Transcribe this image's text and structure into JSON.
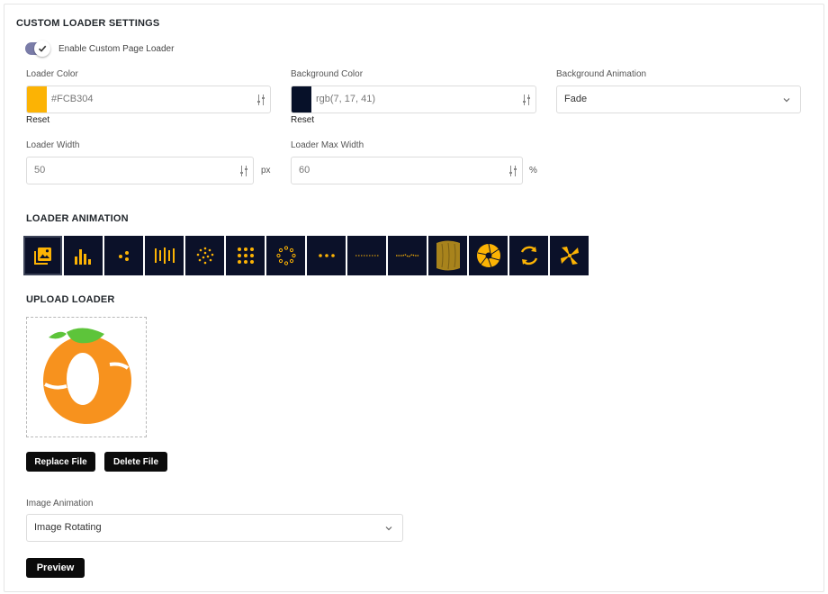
{
  "section_title": "CUSTOM LOADER SETTINGS",
  "enable_loader": {
    "label": "Enable Custom Page Loader",
    "checked": true
  },
  "loader_color": {
    "label": "Loader Color",
    "value": "#FCB304",
    "swatch": "#fcb304",
    "reset": "Reset"
  },
  "background_color": {
    "label": "Background Color",
    "value": "rgb(7, 17, 41)",
    "swatch": "#071129",
    "reset": "Reset"
  },
  "background_animation": {
    "label": "Background Animation",
    "value": "Fade"
  },
  "loader_width": {
    "label": "Loader Width",
    "value": "50",
    "unit": "px"
  },
  "loader_max_width": {
    "label": "Loader Max Width",
    "value": "60",
    "unit": "%"
  },
  "loader_animation": {
    "title": "LOADER ANIMATION",
    "selected": "image-icon",
    "icons": [
      "image-icon",
      "bars-icon",
      "dots-triangle-icon",
      "vertical-bars-icon",
      "dot-burst-icon",
      "dot-grid-icon",
      "dot-ring-icon",
      "three-dots-icon",
      "dashed-line-icon",
      "wave-line-icon",
      "cylinder-icon",
      "aperture-icon",
      "circular-arrows-icon",
      "pinwheel-icon"
    ],
    "accent": "#fcb304"
  },
  "upload_loader": {
    "title": "UPLOAD LOADER",
    "image_icon": "orange-fruit-logo-icon"
  },
  "buttons": {
    "replace": "Replace File",
    "delete": "Delete File",
    "preview": "Preview"
  },
  "image_animation": {
    "label": "Image Animation",
    "value": "Image Rotating"
  }
}
